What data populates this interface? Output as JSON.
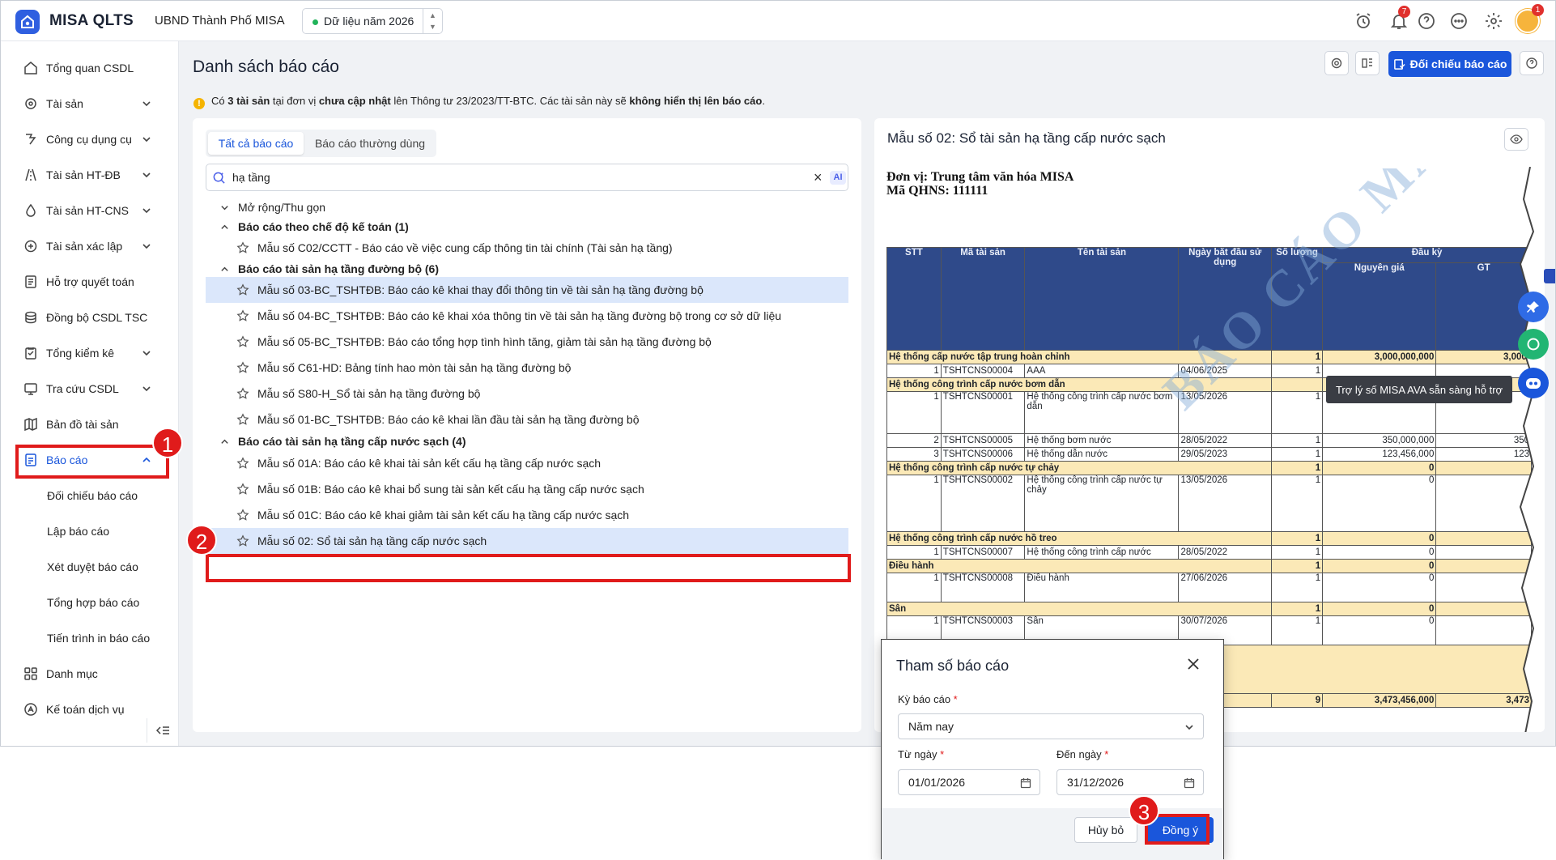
{
  "app": {
    "name": "MISA QLTS",
    "org": "UBND Thành Phố MISA",
    "year_label": "Dữ liệu năm 2026",
    "notif_count": "7",
    "avatar_badge": "1"
  },
  "sidebar": {
    "items": [
      {
        "label": "Tổng quan CSDL",
        "icon": "home-icon"
      },
      {
        "label": "Tài sản",
        "icon": "assets-icon"
      },
      {
        "label": "Công cụ dụng cụ",
        "icon": "tools-icon"
      },
      {
        "label": "Tài sản HT-ĐB",
        "icon": "road-icon"
      },
      {
        "label": "Tài sản HT-CNS",
        "icon": "water-drop-icon"
      },
      {
        "label": "Tài sản xác lập",
        "icon": "establish-icon"
      },
      {
        "label": "Hỗ trợ quyết toán",
        "icon": "document-icon"
      },
      {
        "label": "Đồng bộ CSDL TSC",
        "icon": "sync-icon"
      },
      {
        "label": "Tổng kiểm kê",
        "icon": "checklist-icon"
      },
      {
        "label": "Tra cứu CSDL",
        "icon": "lookup-icon"
      },
      {
        "label": "Bản đồ tài sản",
        "icon": "map-icon"
      },
      {
        "label": "Báo cáo",
        "icon": "report-icon"
      }
    ],
    "report_sub": [
      "Đối chiếu báo cáo",
      "Lập báo cáo",
      "Xét duyệt báo cáo",
      "Tổng hợp báo cáo",
      "Tiến trình in báo cáo"
    ],
    "bottom": [
      {
        "label": "Danh mục",
        "icon": "grid-icon"
      },
      {
        "label": "Kế toán dịch vụ",
        "icon": "accounting-icon"
      }
    ]
  },
  "page": {
    "title": "Danh sách báo cáo",
    "reconcile_button": "Đối chiếu báo cáo",
    "warning": {
      "p1": "Có ",
      "b1": "3 tài sản",
      "p2": " tại đơn vị ",
      "b2": "chưa cập nhật",
      "p3": " lên Thông tư 23/2023/TT-BTC. Các tài sản này sẽ ",
      "b3": "không hiển thị lên báo cáo",
      "p4": "."
    }
  },
  "list": {
    "tabs": [
      "Tất cả báo cáo",
      "Báo cáo thường dùng"
    ],
    "search_value": "hạ tầng",
    "ai_label": "AI",
    "expand_label": "Mở rộng/Thu gọn",
    "groups": [
      {
        "title": "Báo cáo theo chế độ kế toán (1)",
        "items": [
          "Mẫu số C02/CCTT - Báo cáo về việc cung cấp thông tin tài chính (Tài sản hạ tầng)"
        ]
      },
      {
        "title": "Báo cáo tài sản hạ tầng đường bộ (6)",
        "items": [
          "Mẫu số 03-BC_TSHTĐB: Báo cáo kê khai thay đổi thông tin về tài sản hạ tầng đường bộ",
          "Mẫu số 04-BC_TSHTĐB: Báo cáo kê khai xóa thông tin về tài sản hạ tầng đường bộ trong cơ sở dữ liệu",
          "Mẫu số 05-BC_TSHTĐB: Báo cáo tổng hợp tình hình tăng, giảm tài sản hạ tầng đường bộ",
          "Mẫu số C61-HD: Bảng tính hao mòn tài sản hạ tầng đường bộ",
          "Mẫu số S80-H_Sổ tài sản hạ tầng đường bộ",
          "Mẫu số 01-BC_TSHTĐB: Báo cáo kê khai lần đầu tài sản hạ tầng đường bộ"
        ]
      },
      {
        "title": "Báo cáo tài sản hạ tầng cấp nước sạch (4)",
        "items": [
          "Mẫu số 01A: Báo cáo kê khai tài sản kết cấu hạ tầng cấp nước sạch",
          "Mẫu số 01B: Báo cáo kê khai bổ sung tài sản kết cấu hạ tầng cấp nước sạch",
          "Mẫu số 01C: Báo cáo kê khai giảm tài sản kết cấu hạ tầng cấp nước sạch",
          "Mẫu số 02: Sổ tài sản hạ tầng cấp nước sạch"
        ]
      }
    ]
  },
  "preview": {
    "title": "Mẫu số 02: Sổ tài sản hạ tầng cấp nước sạch",
    "unit_line1": "Đơn vị: Trung tâm văn hóa MISA",
    "unit_line2": "Mã QHNS: 111111",
    "headers": [
      "STT",
      "Mã tài sản",
      "Tên tài sản",
      "Ngày bắt đầu sử dụng",
      "Số lượng",
      "Đầu kỳ",
      "Nguyên giá",
      "GT"
    ],
    "rows": [
      {
        "type": "group",
        "c": [
          "Hệ thống cấp nước tập trung hoàn chỉnh",
          "",
          "",
          "",
          "1",
          "3,000,000,000",
          "3,000,"
        ]
      },
      {
        "type": "item",
        "c": [
          "1",
          "TSHTCNS00004",
          "AAA",
          "04/06/2025",
          "1",
          "",
          ""
        ]
      },
      {
        "type": "group",
        "c": [
          "Hệ thống công trình cấp nước bơm dẫn",
          "",
          "",
          "",
          "",
          "",
          ""
        ]
      },
      {
        "type": "item",
        "c": [
          "1",
          "TSHTCNS00001",
          "Hệ thống công trình cấp nước bơm dẫn",
          "13/05/2026",
          "1",
          "",
          ""
        ]
      },
      {
        "type": "item",
        "c": [
          "2",
          "TSHTCNS00005",
          "Hệ thống bơm nước",
          "28/05/2022",
          "1",
          "350,000,000",
          "350"
        ]
      },
      {
        "type": "item",
        "c": [
          "3",
          "TSHTCNS00006",
          "Hệ thống dẫn nước",
          "29/05/2023",
          "1",
          "123,456,000",
          "123"
        ]
      },
      {
        "type": "group",
        "c": [
          "Hệ thống công trình cấp nước tự chảy",
          "",
          "",
          "",
          "1",
          "0",
          ""
        ]
      },
      {
        "type": "item",
        "c": [
          "1",
          "TSHTCNS00002",
          "Hệ thống công trình cấp nước tự chảy",
          "13/05/2026",
          "1",
          "0",
          ""
        ]
      },
      {
        "type": "group",
        "c": [
          "Hệ thống công trình cấp nước hồ treo",
          "",
          "",
          "",
          "1",
          "0",
          ""
        ]
      },
      {
        "type": "item",
        "c": [
          "1",
          "TSHTCNS00007",
          "Hệ thống công trình cấp nước",
          "28/05/2022",
          "1",
          "0",
          ""
        ]
      },
      {
        "type": "group",
        "c": [
          "Điều hành",
          "",
          "",
          "",
          "1",
          "0",
          ""
        ]
      },
      {
        "type": "item",
        "c": [
          "1",
          "TSHTCNS00008",
          "Điều hành",
          "27/06/2026",
          "1",
          "0",
          ""
        ]
      },
      {
        "type": "group",
        "c": [
          "Sân",
          "",
          "",
          "",
          "1",
          "0",
          ""
        ]
      },
      {
        "type": "item",
        "c": [
          "1",
          "TSHTCNS00003",
          "Sân",
          "30/07/2026",
          "1",
          "0",
          ""
        ]
      },
      {
        "type": "total",
        "c": [
          "",
          "",
          "",
          "",
          "9",
          "3,473,456,000",
          "3,473"
        ]
      }
    ],
    "watermark": "BÁO CÁO MẪU",
    "ava_tooltip": "Trợ lý số MISA AVA sẵn sàng hỗ trợ"
  },
  "dialog": {
    "title": "Tham số báo cáo",
    "period_label": "Kỳ báo cáo",
    "period_value": "Năm nay",
    "from_label": "Từ ngày",
    "from_value": "01/01/2026",
    "to_label": "Đến ngày",
    "to_value": "31/12/2026",
    "cancel": "Hủy bỏ",
    "ok": "Đồng ý",
    "required_mark": "*"
  },
  "steps": [
    "1",
    "2",
    "3"
  ],
  "colors": {
    "primary": "#1a56db",
    "annotation_red": "#e01b1b",
    "highlight_row": "#dbe7fb",
    "table_header": "#2f4a8a",
    "group_row": "#fbe9b7"
  }
}
